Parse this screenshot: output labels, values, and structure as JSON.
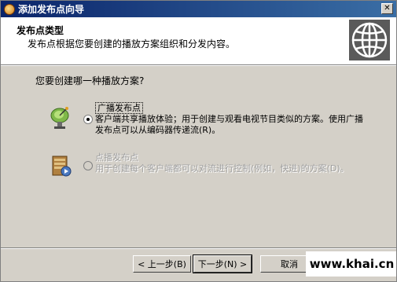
{
  "window": {
    "title": "添加发布点向导",
    "close_label": "✕"
  },
  "header": {
    "title": "发布点类型",
    "description": "发布点根据您要创建的播放方案组织和分发内容。"
  },
  "question": "您要创建哪一种播放方案?",
  "options": [
    {
      "label": "广播发布点",
      "description": "客户端共享播放体验；用于创建与观看电视节目类似的方案。使用广播发布点可以从编码器传递流(R)。",
      "checked": true,
      "enabled": true
    },
    {
      "label": "点播发布点",
      "description": "用于创建每个客户端都可以对流进行控制(例如，快进)的方案(D)。",
      "checked": false,
      "enabled": false
    }
  ],
  "buttons": {
    "back": "< 上一步(B)",
    "next": "下一步(N) >",
    "cancel": "取消"
  },
  "watermark": "www.khai.cn"
}
